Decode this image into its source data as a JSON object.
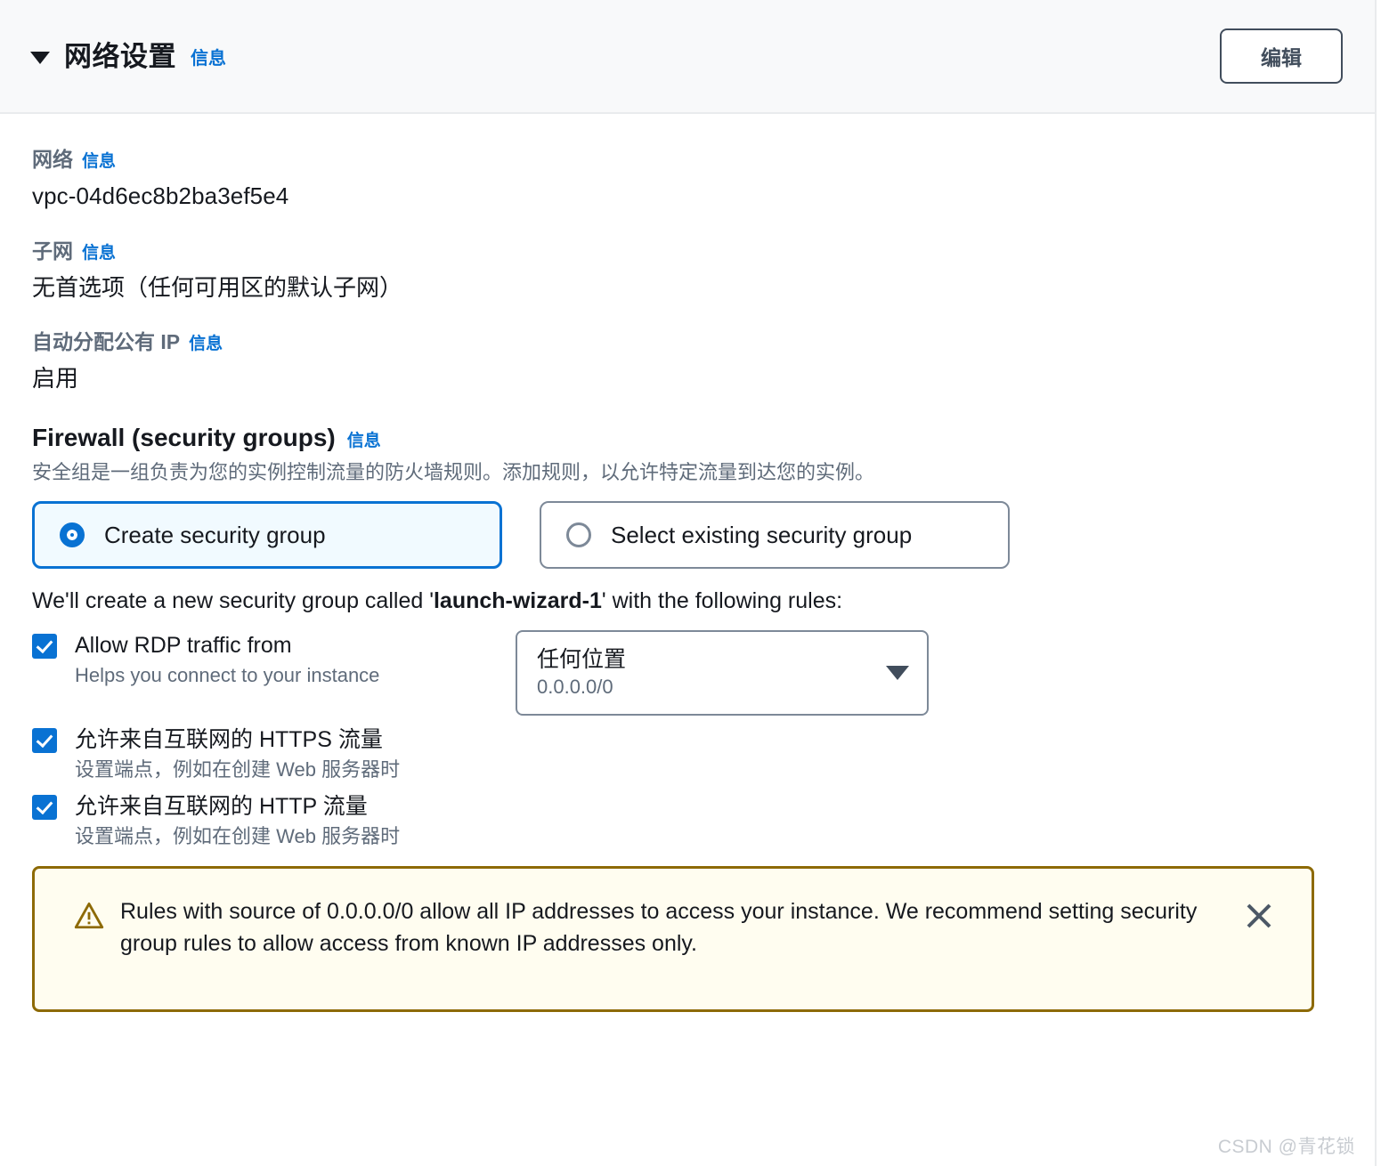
{
  "header": {
    "title": "网络设置",
    "info_label": "信息",
    "edit_button": "编辑",
    "caret_icon": "caret-down-icon"
  },
  "fields": [
    {
      "label": "网络",
      "info_label": "信息",
      "value": "vpc-04d6ec8b2ba3ef5e4"
    },
    {
      "label": "子网",
      "info_label": "信息",
      "value": "无首选项（任何可用区的默认子网）"
    },
    {
      "label": "自动分配公有 IP",
      "info_label": "信息",
      "value": "启用"
    }
  ],
  "firewall": {
    "title": "Firewall (security groups)",
    "info_label": "信息",
    "description": "安全组是一组负责为您的实例控制流量的防火墙规则。添加规则，以允许特定流量到达您的实例。",
    "options": [
      {
        "label": "Create security group",
        "selected": true
      },
      {
        "label": "Select existing security group",
        "selected": false
      }
    ],
    "rules_intro_prefix": "We'll create a new security group called '",
    "rules_intro_name": "launch-wizard-1",
    "rules_intro_suffix": "' with the following rules:",
    "rules": [
      {
        "label": "Allow RDP traffic from",
        "sub": "Helps you connect to your instance",
        "checked": true,
        "source_select": {
          "value": "任何位置",
          "cidr": "0.0.0.0/0",
          "caret_icon": "caret-down-icon"
        }
      },
      {
        "label": "允许来自互联网的 HTTPS 流量",
        "sub": "设置端点，例如在创建 Web 服务器时",
        "checked": true
      },
      {
        "label": "允许来自互联网的 HTTP 流量",
        "sub": "设置端点，例如在创建 Web 服务器时",
        "checked": true
      }
    ]
  },
  "alert": {
    "icon": "warning-triangle-icon",
    "message": "Rules with source of 0.0.0.0/0 allow all IP addresses to access your instance. We recommend setting security group rules to allow access from known IP addresses only.",
    "close_icon": "close-icon"
  },
  "watermark": "CSDN @青花锁",
  "colors": {
    "accent": "#0972d3",
    "warning_border": "#8d6a05",
    "warning_bg": "#fffdf0",
    "label_gray": "#5f6b7a",
    "header_bg": "#f8f9fa"
  }
}
